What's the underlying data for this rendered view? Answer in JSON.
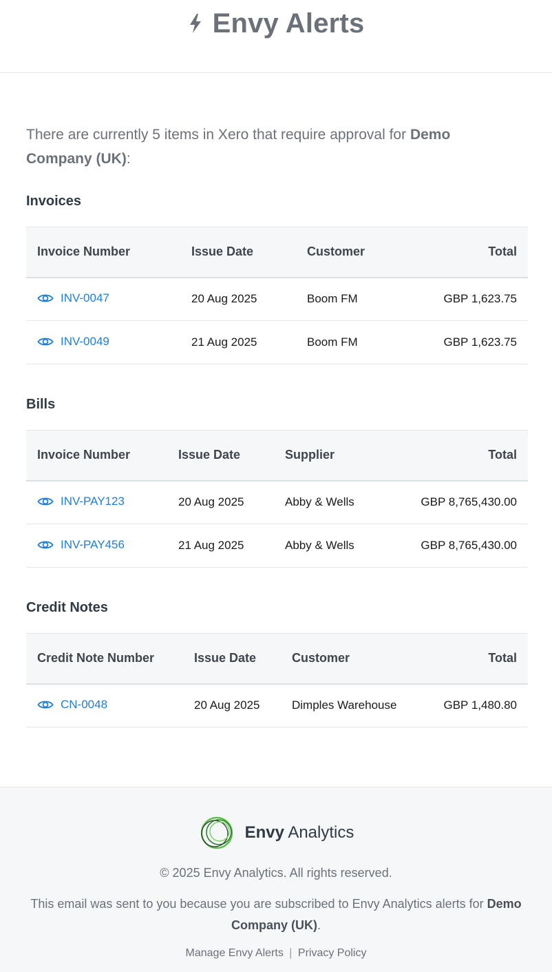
{
  "header": {
    "title": "Envy Alerts",
    "icon": "lightning-bolt-icon"
  },
  "intro": {
    "text_before": "There are currently 5 items in Xero that require approval for ",
    "company": "Demo Company (UK)",
    "text_after": ":"
  },
  "invoices": {
    "title": "Invoices",
    "columns": [
      "Invoice Number",
      "Issue Date",
      "Customer",
      "Total"
    ],
    "rows": [
      {
        "number": "INV-0047",
        "date": "20 Aug 2025",
        "party": "Boom FM",
        "total": "GBP 1,623.75"
      },
      {
        "number": "INV-0049",
        "date": "21 Aug 2025",
        "party": "Boom FM",
        "total": "GBP 1,623.75"
      }
    ]
  },
  "bills": {
    "title": "Bills",
    "columns": [
      "Invoice Number",
      "Issue Date",
      "Supplier",
      "Total"
    ],
    "rows": [
      {
        "number": "INV-PAY123",
        "date": "20 Aug 2025",
        "party": "Abby & Wells",
        "total": "GBP 8,765,430.00"
      },
      {
        "number": "INV-PAY456",
        "date": "21 Aug 2025",
        "party": "Abby & Wells",
        "total": "GBP 8,765,430.00"
      }
    ]
  },
  "credit_notes": {
    "title": "Credit Notes",
    "columns": [
      "Credit Note Number",
      "Issue Date",
      "Customer",
      "Total"
    ],
    "rows": [
      {
        "number": "CN-0048",
        "date": "20 Aug 2025",
        "party": "Dimples Warehouse",
        "total": "GBP 1,480.80"
      }
    ]
  },
  "footer": {
    "brand_bold": "Envy",
    "brand_rest": " Analytics",
    "copyright": "© 2025 Envy Analytics. All rights reserved.",
    "notice_before": "This email was sent to you because you are subscribed to Envy Analytics alerts for ",
    "notice_company": "Demo Company (UK)",
    "notice_after": ".",
    "manage_link": "Manage Envy Alerts",
    "separator": "|",
    "privacy_link": "Privacy Policy"
  },
  "colors": {
    "link": "#1f7ed6",
    "header_text": "#6b7179",
    "footer_bg": "#f6f7f9",
    "logo_green": "#4cc13a"
  }
}
